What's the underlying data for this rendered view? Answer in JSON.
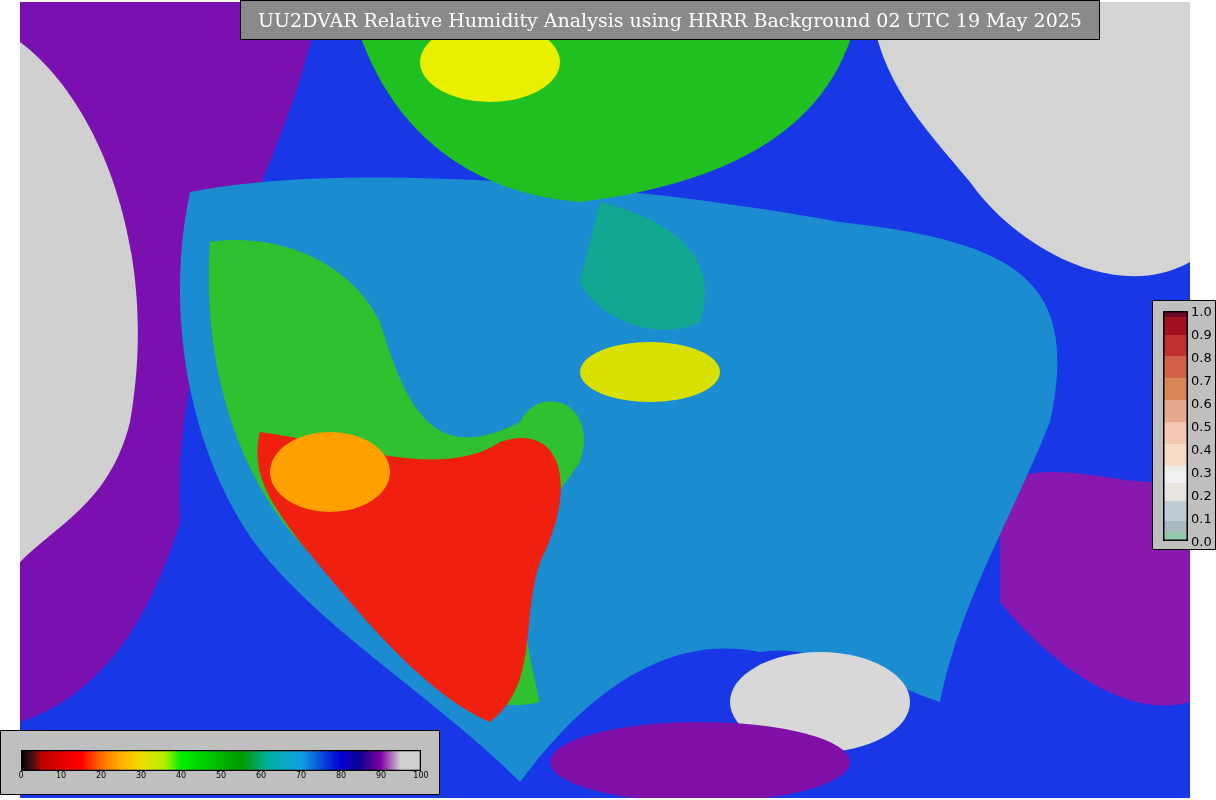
{
  "title": "UU2DVAR Relative Humidity Analysis using HRRR Background 02 UTC 19 May 2025",
  "colorbar_right": {
    "ticks": [
      "1.0",
      "0.9",
      "0.8",
      "0.7",
      "0.6",
      "0.5",
      "0.4",
      "0.3",
      "0.2",
      "0.1",
      "0.0"
    ]
  },
  "colorbar_bottom": {
    "ticks": [
      "0",
      "10",
      "20",
      "30",
      "40",
      "50",
      "60",
      "70",
      "80",
      "90",
      "100"
    ]
  }
}
